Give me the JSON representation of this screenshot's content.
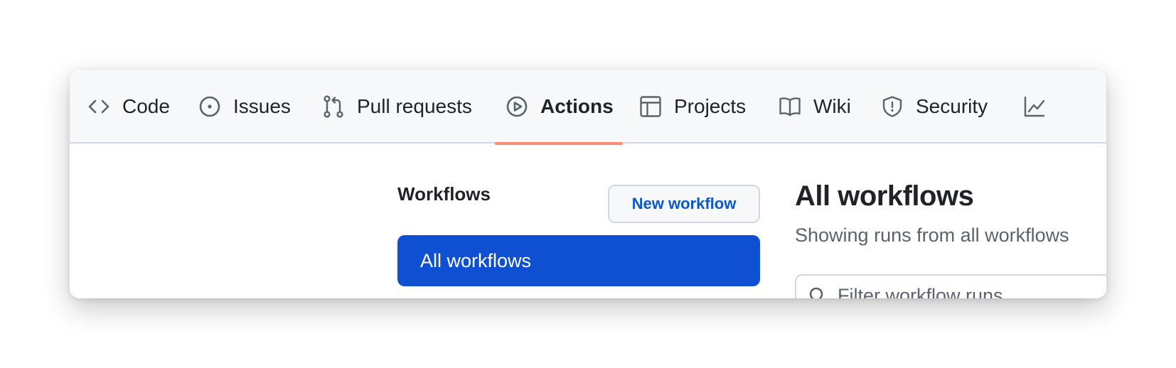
{
  "tabs": [
    {
      "label": "Code",
      "icon": "code-icon",
      "active": false
    },
    {
      "label": "Issues",
      "icon": "issue-opened-icon",
      "active": false
    },
    {
      "label": "Pull requests",
      "icon": "git-pull-request-icon",
      "active": false
    },
    {
      "label": "Actions",
      "icon": "play-icon",
      "active": true
    },
    {
      "label": "Projects",
      "icon": "table-icon",
      "active": false
    },
    {
      "label": "Wiki",
      "icon": "book-icon",
      "active": false
    },
    {
      "label": "Security",
      "icon": "shield-icon",
      "active": false
    },
    {
      "label": "",
      "icon": "graph-icon",
      "active": false
    }
  ],
  "sidebar": {
    "title": "Workflows",
    "new_workflow_label": "New workflow",
    "items": [
      {
        "label": "All workflows",
        "selected": true
      }
    ]
  },
  "main": {
    "title": "All workflows",
    "subtitle": "Showing runs from all workflows",
    "filter_placeholder": "Filter workflow runs"
  },
  "colors": {
    "tab_underline": "#fd8c73",
    "selected_nav_bg": "#0f4fd1",
    "link_blue": "#0a58ca"
  }
}
